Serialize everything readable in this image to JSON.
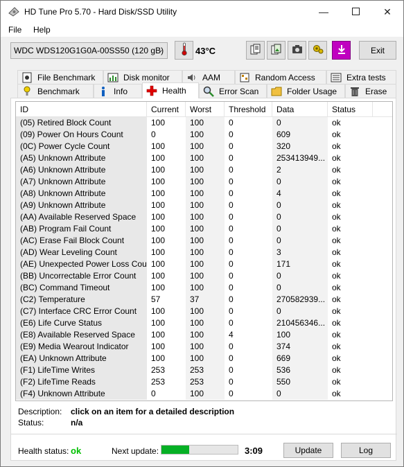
{
  "window": {
    "title": "HD Tune Pro 5.70 - Hard Disk/SSD Utility"
  },
  "menu": {
    "file": "File",
    "help": "Help"
  },
  "toolbar": {
    "drive": "WDC WDS120G1G0A-00SS50 (120 gB)",
    "temperature": "43°C",
    "exit_label": "Exit",
    "buttons": [
      "copy-text-icon",
      "copy-image-icon",
      "camera-icon",
      "settings-icon",
      "save-icon"
    ]
  },
  "tabs": {
    "row1": [
      "File Benchmark",
      "Disk monitor",
      "AAM",
      "Random Access",
      "Extra tests"
    ],
    "row2": [
      "Benchmark",
      "Info",
      "Health",
      "Error Scan",
      "Folder Usage",
      "Erase"
    ],
    "active": "Health"
  },
  "table": {
    "headers": [
      "ID",
      "Current",
      "Worst",
      "Threshold",
      "Data",
      "Status"
    ],
    "rows": [
      [
        "(05) Retired Block Count",
        "100",
        "100",
        "0",
        "0",
        "ok"
      ],
      [
        "(09) Power On Hours Count",
        "0",
        "100",
        "0",
        "609",
        "ok"
      ],
      [
        "(0C) Power Cycle Count",
        "100",
        "100",
        "0",
        "320",
        "ok"
      ],
      [
        "(A5) Unknown Attribute",
        "100",
        "100",
        "0",
        "253413949...",
        "ok"
      ],
      [
        "(A6) Unknown Attribute",
        "100",
        "100",
        "0",
        "2",
        "ok"
      ],
      [
        "(A7) Unknown Attribute",
        "100",
        "100",
        "0",
        "0",
        "ok"
      ],
      [
        "(A8) Unknown Attribute",
        "100",
        "100",
        "0",
        "4",
        "ok"
      ],
      [
        "(A9) Unknown Attribute",
        "100",
        "100",
        "0",
        "0",
        "ok"
      ],
      [
        "(AA) Available Reserved Space",
        "100",
        "100",
        "0",
        "0",
        "ok"
      ],
      [
        "(AB) Program Fail Count",
        "100",
        "100",
        "0",
        "0",
        "ok"
      ],
      [
        "(AC) Erase Fail Block Count",
        "100",
        "100",
        "0",
        "0",
        "ok"
      ],
      [
        "(AD) Wear Leveling Count",
        "100",
        "100",
        "0",
        "3",
        "ok"
      ],
      [
        "(AE) Unexpected Power Loss Count",
        "100",
        "100",
        "0",
        "171",
        "ok"
      ],
      [
        "(BB) Uncorrectable Error Count",
        "100",
        "100",
        "0",
        "0",
        "ok"
      ],
      [
        "(BC) Command Timeout",
        "100",
        "100",
        "0",
        "0",
        "ok"
      ],
      [
        "(C2) Temperature",
        "57",
        "37",
        "0",
        "270582939...",
        "ok"
      ],
      [
        "(C7) Interface CRC Error Count",
        "100",
        "100",
        "0",
        "0",
        "ok"
      ],
      [
        "(E6) Life Curve Status",
        "100",
        "100",
        "0",
        "210456346...",
        "ok"
      ],
      [
        "(E8) Available Reserved Space",
        "100",
        "100",
        "4",
        "100",
        "ok"
      ],
      [
        "(E9) Media Wearout Indicator",
        "100",
        "100",
        "0",
        "374",
        "ok"
      ],
      [
        "(EA) Unknown Attribute",
        "100",
        "100",
        "0",
        "669",
        "ok"
      ],
      [
        "(F1) LifeTime Writes",
        "253",
        "253",
        "0",
        "536",
        "ok"
      ],
      [
        "(F2) LifeTime Reads",
        "253",
        "253",
        "0",
        "550",
        "ok"
      ],
      [
        "(F4) Unknown Attribute",
        "0",
        "100",
        "0",
        "0",
        "ok"
      ]
    ]
  },
  "details": {
    "description_label": "Description:",
    "description_value": "click on an item for a detailed description",
    "status_label": "Status:",
    "status_value": "n/a"
  },
  "footer": {
    "health_label": "Health status:",
    "health_value": "ok",
    "next_update_label": "Next update:",
    "next_update_time": "3:09",
    "progress_fraction": 0.36,
    "update_label": "Update",
    "log_label": "Log"
  },
  "colors": {
    "ok_green": "#00c000",
    "progress_green": "#06b025",
    "temp_red": "#d00000"
  }
}
